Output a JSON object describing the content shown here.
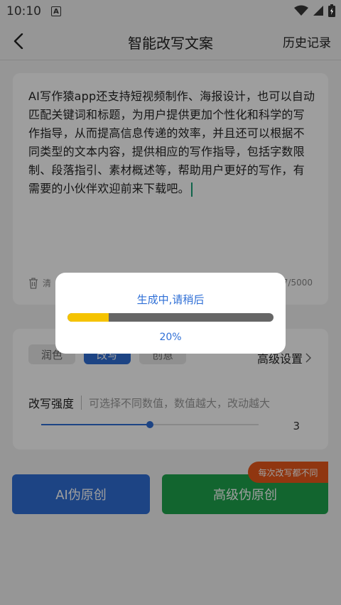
{
  "status_bar": {
    "time": "10:10",
    "a_badge": "A"
  },
  "header": {
    "title": "智能改写文案",
    "history": "历史记录"
  },
  "editor": {
    "content": "AI写作猿app还支持短视频制作、海报设计，也可以自动匹配关键词和标题，为用户提供更加个性化和科学的写作指导，从而提高信息传递的效率，并且还可以根据不同类型的文本内容，提供相应的写作指导，包括字数限制、段落指引、素材概述等，帮助用户更好的写作，有需要的小伙伴欢迎前来下载吧。",
    "clear_label": "清",
    "char_count": "7/5000"
  },
  "options": {
    "tabs": [
      "润色",
      "改写",
      "创意"
    ],
    "active_tab_index": 1,
    "advanced_settings": "高级设置",
    "strength_label": "改写强度",
    "strength_hint": "可选择不同数值，数值越大，改动越大",
    "strength_value": "3",
    "strength_fraction": 0.5
  },
  "buttons": {
    "ai": "AI伪原创",
    "advanced": "高级伪原创",
    "promo": "每次改写都不同"
  },
  "modal": {
    "title": "生成中,请稍后",
    "progress_text": "20%",
    "progress": 0.2
  }
}
